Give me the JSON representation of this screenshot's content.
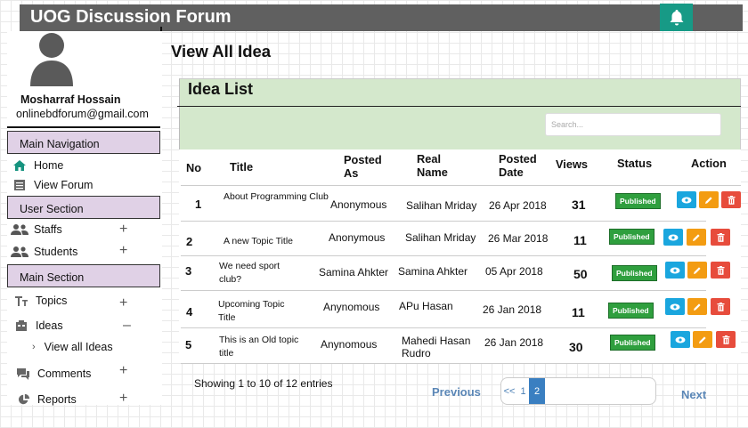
{
  "app": {
    "title": "UOG Discussion Forum",
    "bell_icon": "bell-icon",
    "accent": "#179a86"
  },
  "user": {
    "name": "Mosharraf Hossain",
    "email": "onlinebdforum@gmail.com"
  },
  "sidebar": {
    "sections": [
      {
        "label": "Main Navigation"
      },
      {
        "label": "User Section"
      },
      {
        "label": "Main Section"
      }
    ],
    "items": [
      {
        "label": "Home",
        "icon": "home-icon"
      },
      {
        "label": "View Forum",
        "icon": "list-icon"
      },
      {
        "label": "Staffs",
        "icon": "users-icon"
      },
      {
        "label": "Students",
        "icon": "users-icon"
      },
      {
        "label": "Topics",
        "icon": "text-icon"
      },
      {
        "label": "Ideas",
        "icon": "idea-icon"
      },
      {
        "label": "View all Ideas",
        "icon": "chevron-right-icon"
      },
      {
        "label": "Comments",
        "icon": "comments-icon"
      },
      {
        "label": "Reports",
        "icon": "pie-chart-icon"
      }
    ],
    "toggles": {
      "plus": "+",
      "minus": "–"
    }
  },
  "main": {
    "heading": "View All Idea",
    "panel_title": "Idea List",
    "search": {
      "placeholder": "Search...",
      "value": ""
    },
    "columns": [
      "No",
      "Title",
      "Posted As",
      "Real Name",
      "Posted Date",
      "Views",
      "Status",
      "Action"
    ],
    "rows": [
      {
        "no": "1",
        "title": "About Programming Club",
        "posted_as": "Anonymous",
        "real_name": "Salihan Mriday",
        "date": "26 Apr 2018",
        "views": "31",
        "status": "Published"
      },
      {
        "no": "2",
        "title": "A new Topic Title",
        "posted_as": "Anonymous",
        "real_name": "Salihan Mriday",
        "date": "26 Mar 2018",
        "views": "11",
        "status": "Published"
      },
      {
        "no": "3",
        "title": "We need sport club?",
        "posted_as": "Samina Ahkter",
        "real_name": "Samina Ahkter",
        "date": "05 Apr 2018",
        "views": "50",
        "status": "Published"
      },
      {
        "no": "4",
        "title": "Upcoming Topic Title",
        "posted_as": "Anynomous",
        "real_name": "APu Hasan",
        "date": "26 Jan 2018",
        "views": "11",
        "status": "Published"
      },
      {
        "no": "5",
        "title": "This is an Old topic title",
        "posted_as": "Anynomous",
        "real_name": "Mahedi Hasan Rudro",
        "date": "26 Jan 2018",
        "views": "30",
        "status": "Published"
      }
    ],
    "footer_info": "Showing 1 to 10 of 12 entries",
    "pagination": {
      "previous": "Previous",
      "first": "<<",
      "page1": "1",
      "page2": "2",
      "next": "Next"
    }
  },
  "colors": {
    "header": "#606060",
    "panel": "#d4e8cc",
    "section": "#e0d1e6",
    "published": "#2f9f3e",
    "view": "#1aa6de",
    "edit": "#f39c12",
    "delete": "#e74c3c"
  }
}
